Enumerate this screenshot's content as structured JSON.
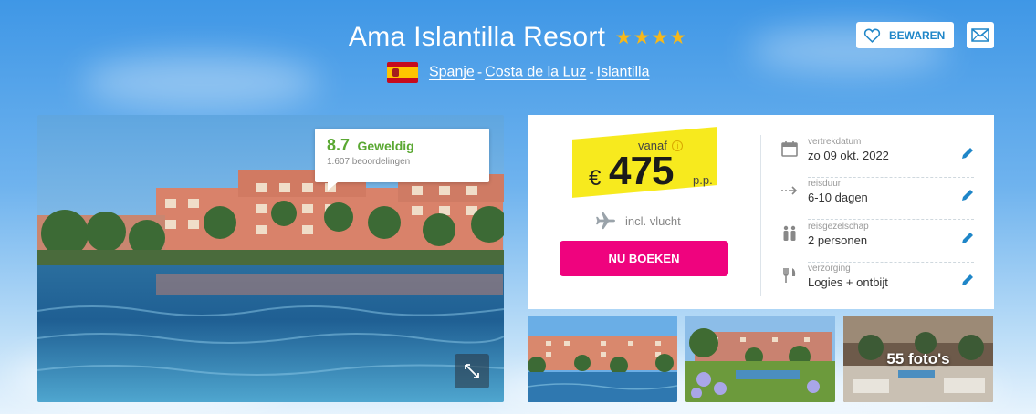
{
  "hotel": {
    "name": "Ama Islantilla Resort",
    "stars": "★★★★"
  },
  "location": {
    "country": "Spanje",
    "region": "Costa de la Luz",
    "place": "Islantilla",
    "separator": "-"
  },
  "actions": {
    "save_label": "BEWAREN"
  },
  "rating": {
    "score": "8.7",
    "word": "Geweldig",
    "count": "1.607 beoordelingen"
  },
  "price": {
    "prefix": "vanaf",
    "info": "i",
    "currency": "€",
    "amount": "475",
    "per": "p.p.",
    "flight": "incl. vlucht",
    "book_label": "NU BOEKEN"
  },
  "details": [
    {
      "label": "vertrekdatum",
      "value": "zo 09 okt. 2022",
      "icon": "calendar-icon"
    },
    {
      "label": "reisduur",
      "value": "6-10 dagen",
      "icon": "duration-icon"
    },
    {
      "label": "reisgezelschap",
      "value": "2 personen",
      "icon": "people-icon"
    },
    {
      "label": "verzorging",
      "value": "Logies + ontbijt",
      "icon": "cutlery-icon"
    }
  ],
  "gallery": {
    "photo_count": "55 foto's"
  },
  "colors": {
    "accent": "#1f86c8",
    "book": "#ef037e",
    "rating": "#5aa832",
    "price_highlight": "#f7ea1e",
    "stars": "#f6b81a"
  }
}
